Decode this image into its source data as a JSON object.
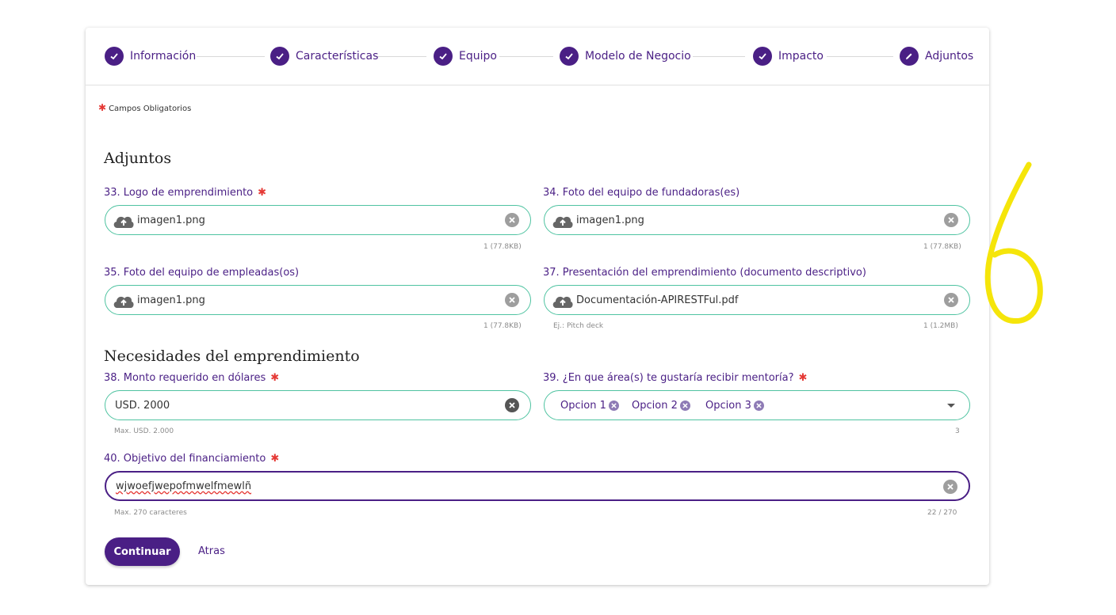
{
  "stepper": {
    "steps": [
      {
        "label": "Información",
        "state": "done"
      },
      {
        "label": "Características",
        "state": "done"
      },
      {
        "label": "Equipo",
        "state": "done"
      },
      {
        "label": "Modelo de Negocio",
        "state": "done"
      },
      {
        "label": "Impacto",
        "state": "done"
      },
      {
        "label": "Adjuntos",
        "state": "editing"
      }
    ]
  },
  "required_note": "Campos Obligatorios",
  "sections": {
    "attachments_title": "Adjuntos",
    "needs_title": "Necesidades del emprendimiento"
  },
  "fields": {
    "logo": {
      "label": "33. Logo de emprendimiento",
      "value": "imagen1.png",
      "count": "1 (77.8KB)",
      "required": true
    },
    "founders_photo": {
      "label": "34. Foto del equipo de fundadoras(es)",
      "value": "imagen1.png",
      "count": "1 (77.8KB)",
      "required": false
    },
    "employees_photo": {
      "label": "35. Foto del equipo de empleadas(os)",
      "value": "imagen1.png",
      "count": "1 (77.8KB)",
      "required": false
    },
    "presentation": {
      "label": "37. Presentación del emprendimiento (documento descriptivo)",
      "value": "Documentación-APIRESTFul.pdf",
      "hint": "Ej.: Pitch deck",
      "count": "1 (1.2MB)",
      "required": false
    },
    "amount": {
      "label": "38. Monto requerido en dólares",
      "value": "USD. 2000",
      "hint": "Max. USD. 2.000",
      "required": true
    },
    "mentorship": {
      "label": "39. ¿En que área(s) te gustaría recibir mentoría?",
      "chips": [
        "Opcion 1",
        "Opcion 2",
        "Opcion 3"
      ],
      "count": "3",
      "required": true
    },
    "objective": {
      "label": "40. Objetivo del financiamiento",
      "value": "wjwoefjwepofmwelfmewlñ",
      "hint": "Max. 270 caracteres",
      "counter": "22 / 270",
      "required": true
    }
  },
  "actions": {
    "continue_label": "Continuar",
    "back_label": "Atras"
  },
  "colors": {
    "primary": "#4a1f85",
    "field_border": "#4fc3a1",
    "required": "#e53935",
    "annotation": "#f5e50a"
  },
  "icons": [
    "check-icon",
    "pencil-icon",
    "cloud-upload-icon",
    "clear-icon",
    "dropdown-arrow-icon"
  ]
}
